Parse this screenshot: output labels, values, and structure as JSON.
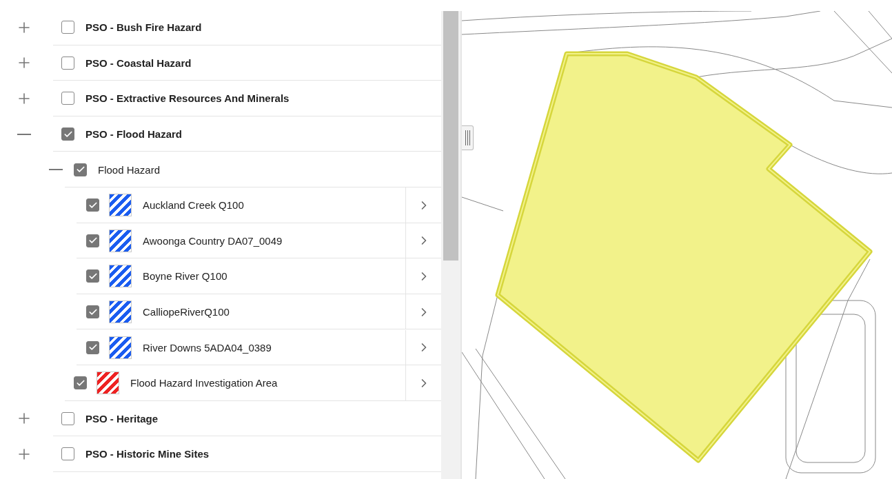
{
  "layers": [
    {
      "label": "PSO - Bush Fire Hazard",
      "kind": "group",
      "expanded": false,
      "checked": false
    },
    {
      "label": "PSO - Coastal Hazard",
      "kind": "group",
      "expanded": false,
      "checked": false
    },
    {
      "label": "PSO - Extractive Resources And Minerals",
      "kind": "group",
      "expanded": false,
      "checked": false
    },
    {
      "label": "PSO - Flood Hazard",
      "kind": "group",
      "expanded": true,
      "checked": true,
      "children": [
        {
          "label": "Flood Hazard",
          "kind": "group",
          "expanded": true,
          "checked": true,
          "children": [
            {
              "label": "Auckland Creek Q100",
              "kind": "layer",
              "checked": true,
              "color": "#1a5cf0"
            },
            {
              "label": "Awoonga Country DA07_0049",
              "kind": "layer",
              "checked": true,
              "color": "#1a5cf0"
            },
            {
              "label": "Boyne River Q100",
              "kind": "layer",
              "checked": true,
              "color": "#1a5cf0"
            },
            {
              "label": "CalliopeRiverQ100",
              "kind": "layer",
              "checked": true,
              "color": "#1a5cf0"
            },
            {
              "label": "River Downs 5ADA04_0389",
              "kind": "layer",
              "checked": true,
              "color": "#1a5cf0"
            }
          ]
        },
        {
          "label": "Flood Hazard Investigation Area",
          "kind": "layer",
          "checked": true,
          "color": "#ee2222"
        }
      ]
    },
    {
      "label": "PSO - Heritage",
      "kind": "group",
      "expanded": false,
      "checked": false
    },
    {
      "label": "PSO - Historic Mine Sites",
      "kind": "group",
      "expanded": false,
      "checked": false
    }
  ]
}
